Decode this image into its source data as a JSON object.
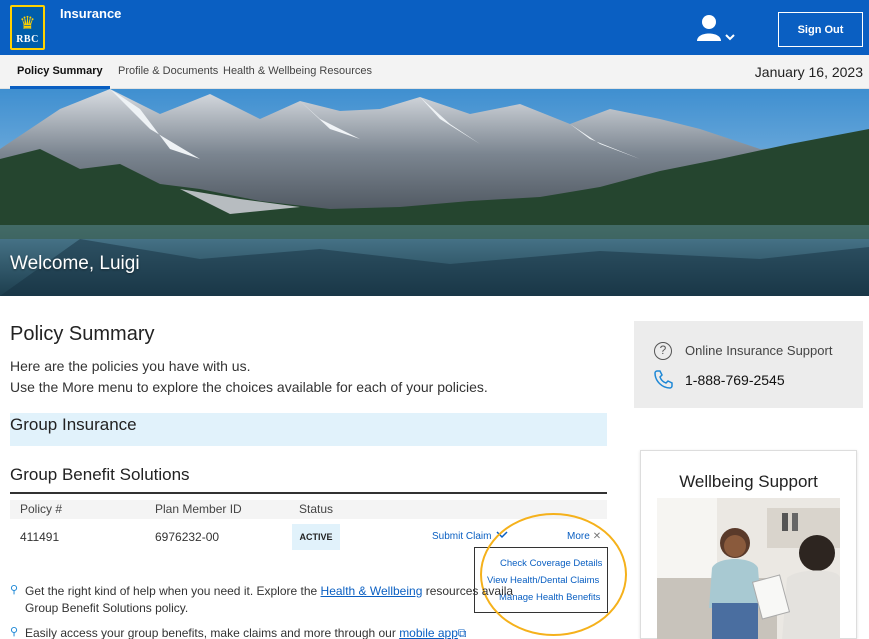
{
  "header": {
    "logo_text": "RBC",
    "app_title": "Insurance",
    "sign_out_label": "Sign Out"
  },
  "nav": {
    "tabs": [
      {
        "label": "Policy Summary",
        "active": true
      },
      {
        "label": "Profile & Documents",
        "active": false
      },
      {
        "label": "Health & Wellbeing Resources",
        "active": false
      }
    ],
    "date": "January 16, 2023"
  },
  "hero": {
    "welcome": "Welcome, Luigi"
  },
  "policy_summary": {
    "title": "Policy Summary",
    "intro_line1": "Here are the policies you have with us.",
    "intro_line2": "Use the More menu to explore the choices available for each of your policies.",
    "group_heading": "Group Insurance",
    "section_title": "Group Benefit Solutions",
    "columns": [
      "Policy #",
      "Plan Member ID",
      "Status"
    ],
    "rows": [
      {
        "policy": "411491",
        "member_id": "6976232-00",
        "status": "ACTIVE"
      }
    ],
    "submit_claim_label": "Submit Claim",
    "more_label": "More",
    "more_menu": [
      "Check Coverage Details",
      "View Health/Dental Claims",
      "Manage Health Benefits"
    ],
    "tip1_before": "Get the right kind of help when you need it. Explore the ",
    "tip1_link": "Health & Wellbeing",
    "tip1_after": " resources availa",
    "tip1_line2": "Group Benefit Solutions policy.",
    "tip2_before": "Easily access your group benefits, make claims and more through our ",
    "tip2_link": "mobile app"
  },
  "support": {
    "label": "Online Insurance Support",
    "phone": "1-888-769-2545"
  },
  "wellbeing": {
    "title": "Wellbeing Support"
  },
  "colors": {
    "brand_blue": "#0a5fc2",
    "highlight": "#f5b11b",
    "light_blue": "#e1f2fb"
  }
}
